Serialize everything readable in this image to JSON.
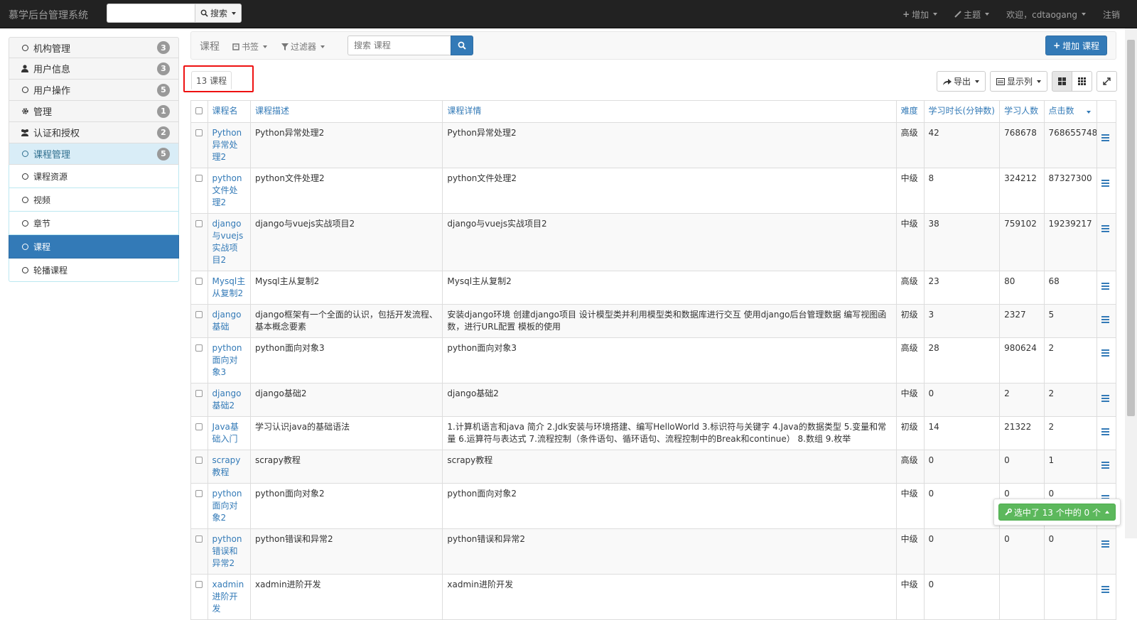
{
  "navbar": {
    "brand": "慕学后台管理系统",
    "search_placeholder": "",
    "search_label": "搜索",
    "add_label": "增加",
    "theme_label": "主题",
    "welcome_label": "欢迎，cdtaogang",
    "logout_label": "注销"
  },
  "sidebar": {
    "items": [
      {
        "label": "机构管理",
        "badge": "3",
        "icon": "circle-o-icon"
      },
      {
        "label": "用户信息",
        "badge": "3",
        "icon": "user-icon"
      },
      {
        "label": "用户操作",
        "badge": "5",
        "icon": "circle-o-icon"
      },
      {
        "label": "管理",
        "badge": "1",
        "icon": "gear-icon"
      },
      {
        "label": "认证和授权",
        "badge": "2",
        "icon": "users-icon"
      },
      {
        "label": "课程管理",
        "badge": "5",
        "icon": "circle-o-icon"
      }
    ],
    "subitems": [
      {
        "label": "课程资源"
      },
      {
        "label": "视频"
      },
      {
        "label": "章节"
      },
      {
        "label": "课程"
      },
      {
        "label": "轮播课程"
      }
    ]
  },
  "toolbar": {
    "title": "课程",
    "bookmarks_label": "书签",
    "filter_label": "过滤器",
    "search_placeholder": "搜索 课程",
    "add_course_label": "增加 课程"
  },
  "count_tab": "13 课程",
  "tools": {
    "export_label": "导出",
    "columns_label": "显示列"
  },
  "table": {
    "headers": [
      "课程名",
      "课程描述",
      "课程详情",
      "难度",
      "学习时长(分钟数)",
      "学习人数",
      "点击数"
    ],
    "rows": [
      [
        "Python异常处理2",
        "Python异常处理2",
        "Python异常处理2",
        "高级",
        "42",
        "768678",
        "768655748"
      ],
      [
        "python文件处理2",
        "python文件处理2",
        "python文件处理2",
        "中级",
        "8",
        "324212",
        "87327300"
      ],
      [
        "django与vuejs实战项目2",
        "django与vuejs实战项目2",
        "django与vuejs实战项目2",
        "中级",
        "38",
        "759102",
        "19239217"
      ],
      [
        "Mysql主从复制2",
        "Mysql主从复制2",
        "Mysql主从复制2",
        "高级",
        "23",
        "80",
        "68"
      ],
      [
        "django基础",
        "django框架有一个全面的认识，包括开发流程、基本概念要素",
        "安装django环境 创建django项目 设计模型类并利用模型类和数据库进行交互 使用django后台管理数据 编写视图函数，进行URL配置 模板的使用",
        "初级",
        "3",
        "2327",
        "5"
      ],
      [
        "python面向对象3",
        "python面向对象3",
        "python面向对象3",
        "高级",
        "28",
        "980624",
        "2"
      ],
      [
        "django基础2",
        "django基础2",
        "django基础2",
        "中级",
        "0",
        "2",
        "2"
      ],
      [
        "Java基础入门",
        "学习认识java的基础语法",
        "1.计算机语言和java 简介 2.Jdk安装与环境搭建、编写HelloWorld 3.标识符与关键字 4.Java的数据类型 5.变量和常量 6.运算符与表达式 7.流程控制（条件语句、循环语句、流程控制中的Break和continue） 8.数组 9.枚举",
        "初级",
        "14",
        "21322",
        "2"
      ],
      [
        "scrapy教程",
        "scrapy教程",
        "scrapy教程",
        "高级",
        "0",
        "0",
        "1"
      ],
      [
        "python面向对象2",
        "python面向对象2",
        "python面向对象2",
        "中级",
        "0",
        "0",
        "0"
      ],
      [
        "python错误和异常2",
        "python错误和异常2",
        "python错误和异常2",
        "中级",
        "0",
        "0",
        "0"
      ],
      [
        "xadmin进阶开发",
        "xadmin进阶开发",
        "xadmin进阶开发",
        "中级",
        "0",
        "",
        ""
      ]
    ]
  },
  "selection_label": "选中了 13 个中的 0 个",
  "colors": {
    "navbar_bg": "#222222",
    "primary": "#337ab7",
    "success": "#5cb85c",
    "highlight": "#ee1111"
  }
}
